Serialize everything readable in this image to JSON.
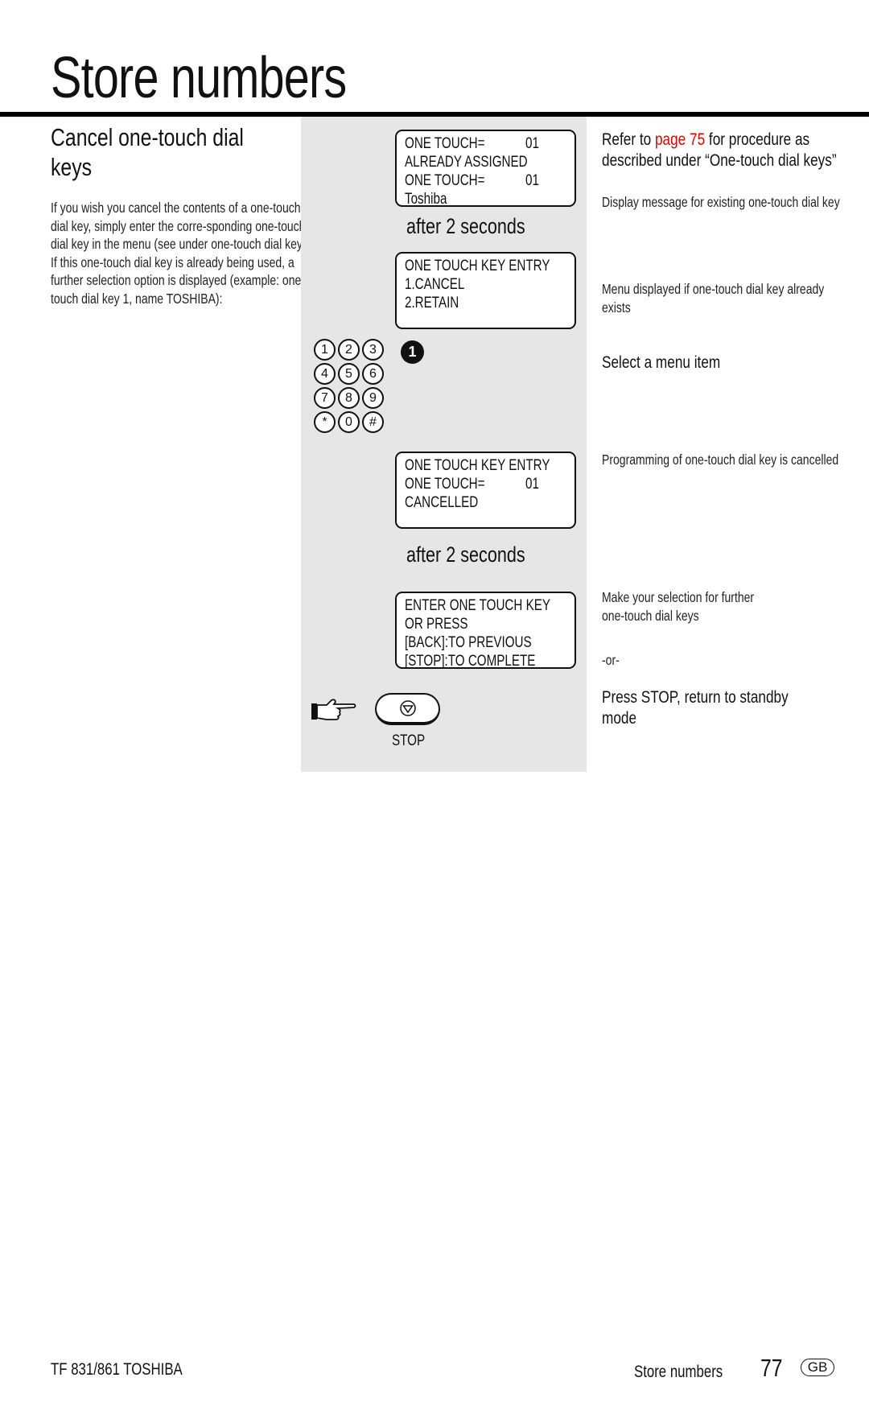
{
  "title": "Store numbers",
  "left": {
    "heading": "Cancel one-touch dial keys",
    "body": "If you wish you cancel the contents of a one-touch dial key, simply enter the corre-sponding one-touch dial key in the menu (see under one-touch dial keys). If this one-touch dial key is already being used, a further selection option is displayed (example: one-touch dial key 1, name TOSHIBA):"
  },
  "displays": [
    {
      "lines": [
        {
          "text": "ONE TOUCH=",
          "num": "01"
        },
        {
          "text": "ALREADY ASSIGNED"
        },
        {
          "text": "ONE TOUCH=",
          "num": "01"
        },
        {
          "text": "Toshiba"
        }
      ]
    },
    {
      "lines": [
        {
          "text": "ONE TOUCH KEY ENTRY"
        },
        {
          "text": "1.CANCEL"
        },
        {
          "text": "2.RETAIN"
        }
      ]
    },
    {
      "lines": [
        {
          "text": "ONE TOUCH KEY ENTRY"
        },
        {
          "text": "ONE TOUCH=",
          "num": "01"
        },
        {
          "text": "CANCELLED"
        }
      ]
    },
    {
      "lines": [
        {
          "text": "ENTER ONE TOUCH KEY"
        },
        {
          "text": "OR PRESS"
        },
        {
          "text": "[BACK]:TO PREVIOUS"
        },
        {
          "text": "[STOP]:TO COMPLETE"
        }
      ]
    }
  ],
  "after_label": "after 2 seconds",
  "keypad": [
    "1",
    "2",
    "3",
    "4",
    "5",
    "6",
    "7",
    "8",
    "9",
    "*",
    "0",
    "#"
  ],
  "pressed_key": "1",
  "stop_label": "STOP",
  "right": {
    "refer_pre": "Refer to ",
    "refer_link": "page 75",
    "refer_post": " for procedure as described under “One-touch dial keys”",
    "display_msg": "Display message for existing one-touch dial key",
    "menu_msg": "Menu displayed if one-touch dial key already exists",
    "select": "Select a menu item",
    "cancelled_msg": "Programming of one-touch dial key is cancelled",
    "selection_msg": "Make your selection for further one-touch dial keys",
    "or": "-or-",
    "press_stop": "Press STOP, return to standby mode"
  },
  "colors": {
    "link": "#e10000",
    "panel": "#e6e6e6"
  },
  "footer": {
    "model": "TF 831/861 TOSHIBA",
    "section": "Store numbers",
    "page": "77",
    "country": "GB"
  }
}
